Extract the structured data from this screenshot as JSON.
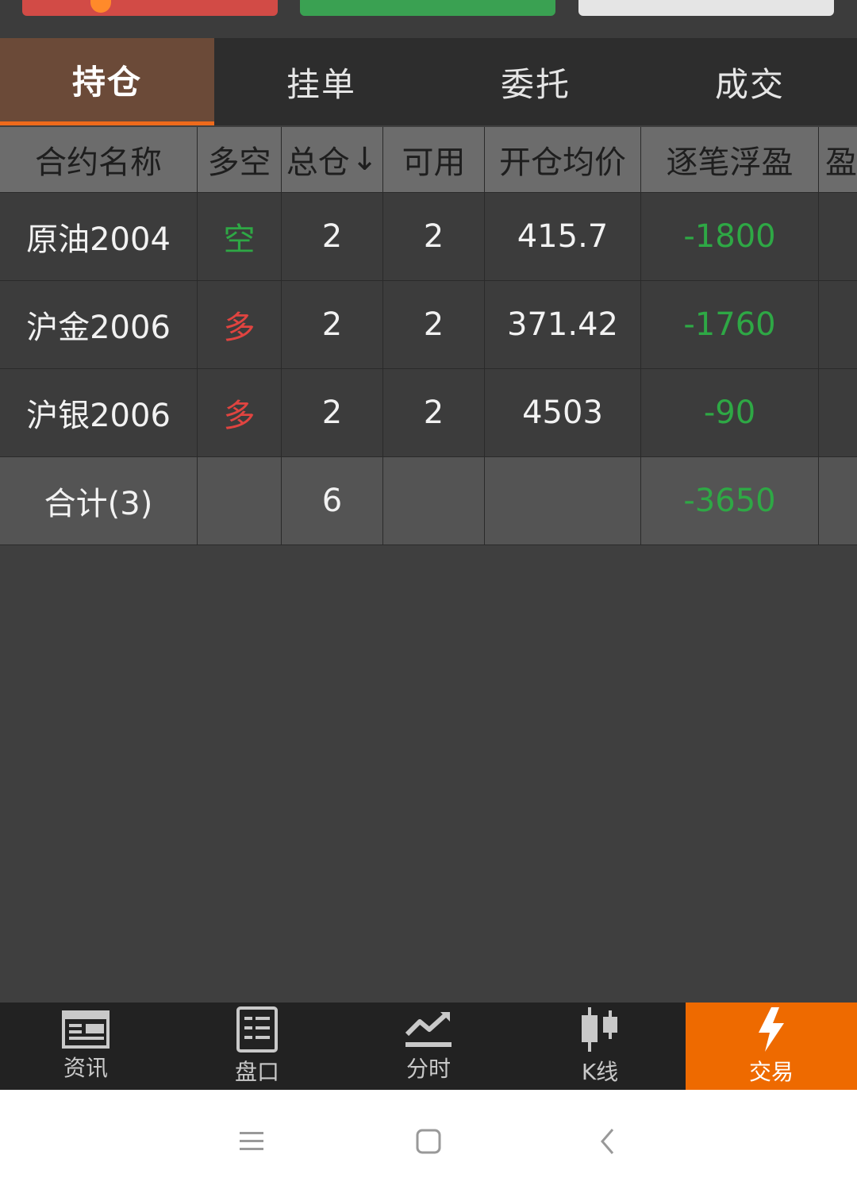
{
  "tabs": [
    {
      "label": "持仓",
      "active": true
    },
    {
      "label": "挂单",
      "active": false
    },
    {
      "label": "委托",
      "active": false
    },
    {
      "label": "成交",
      "active": false
    }
  ],
  "table": {
    "headers": [
      "合约名称",
      "多空",
      "总仓",
      "可用",
      "开仓均价",
      "逐笔浮盈",
      "盈"
    ],
    "sort_indicator": "↓",
    "rows": [
      {
        "name": "原油2004",
        "direction": "空",
        "total": "2",
        "available": "2",
        "avg_price": "415.7",
        "float_pl": "-1800"
      },
      {
        "name": "沪金2006",
        "direction": "多",
        "total": "2",
        "available": "2",
        "avg_price": "371.42",
        "float_pl": "-1760"
      },
      {
        "name": "沪银2006",
        "direction": "多",
        "total": "2",
        "available": "2",
        "avg_price": "4503",
        "float_pl": "-90"
      }
    ],
    "total_row": {
      "label": "合计(3)",
      "total": "6",
      "float_pl": "-3650"
    }
  },
  "bottom_nav": [
    {
      "label": "资讯",
      "icon": "news-icon"
    },
    {
      "label": "盘口",
      "icon": "order-book-icon"
    },
    {
      "label": "分时",
      "icon": "timeshare-chart-icon"
    },
    {
      "label": "K线",
      "icon": "candlestick-icon"
    },
    {
      "label": "交易",
      "icon": "lightning-icon",
      "active": true
    }
  ],
  "colors": {
    "accent": "#ee6a00",
    "profit_green": "#2ea845",
    "long_red": "#e04440",
    "active_tab": "#6b4a38"
  }
}
